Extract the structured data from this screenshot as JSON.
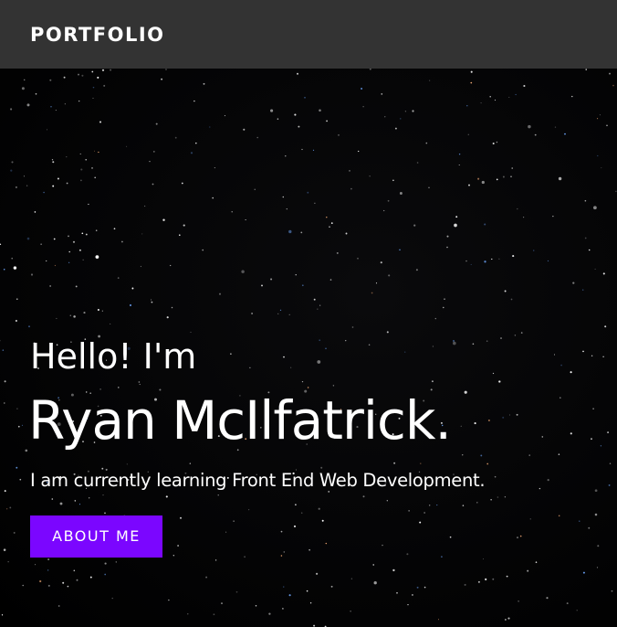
{
  "navbar": {
    "brand": "PORTFOLIO"
  },
  "hero": {
    "greeting": "Hello! I'm",
    "name": "Ryan McIlfatrick.",
    "tagline": "I am currently learning Front End Web Development.",
    "cta_label": "ABOUT ME"
  },
  "colors": {
    "navbar_bg": "#333333",
    "hero_bg": "#000000",
    "accent": "#7b06ff",
    "text": "#ffffff"
  }
}
